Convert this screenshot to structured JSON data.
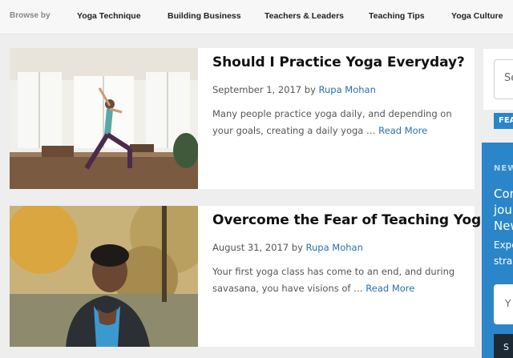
{
  "nav": {
    "browse_label": "Browse by",
    "items": [
      "Yoga Technique",
      "Building Business",
      "Teachers & Leaders",
      "Teaching Tips",
      "Yoga Culture"
    ]
  },
  "posts": [
    {
      "title": "Should I Practice Yoga Everyday?",
      "date": "September 1, 2017",
      "by": "by",
      "author": "Rupa Mohan",
      "excerpt": "Many people practice yoga daily, and depending on your goals, creating a daily yoga …",
      "read_more": "Read More"
    },
    {
      "title": "Overcome the Fear of Teaching Yoga",
      "date": "August 31, 2017",
      "by": "by",
      "author": "Rupa Mohan",
      "excerpt": "Your first yoga class has come to an end, and during savasana, you have visions of …",
      "read_more": "Read More"
    }
  ],
  "sidebar": {
    "search_placeholder_visible": "Se",
    "featured_badge": "FEA",
    "newsletter_label": "NEW",
    "newsletter_title": "Cor\njou\nNew",
    "newsletter_sub": "Expe\nstra",
    "newsletter_input_visible": "Y",
    "newsletter_button_visible": "S"
  },
  "colors": {
    "accent": "#2a86c8",
    "link": "#2a6fb0",
    "dark_button": "#1d2a36"
  }
}
